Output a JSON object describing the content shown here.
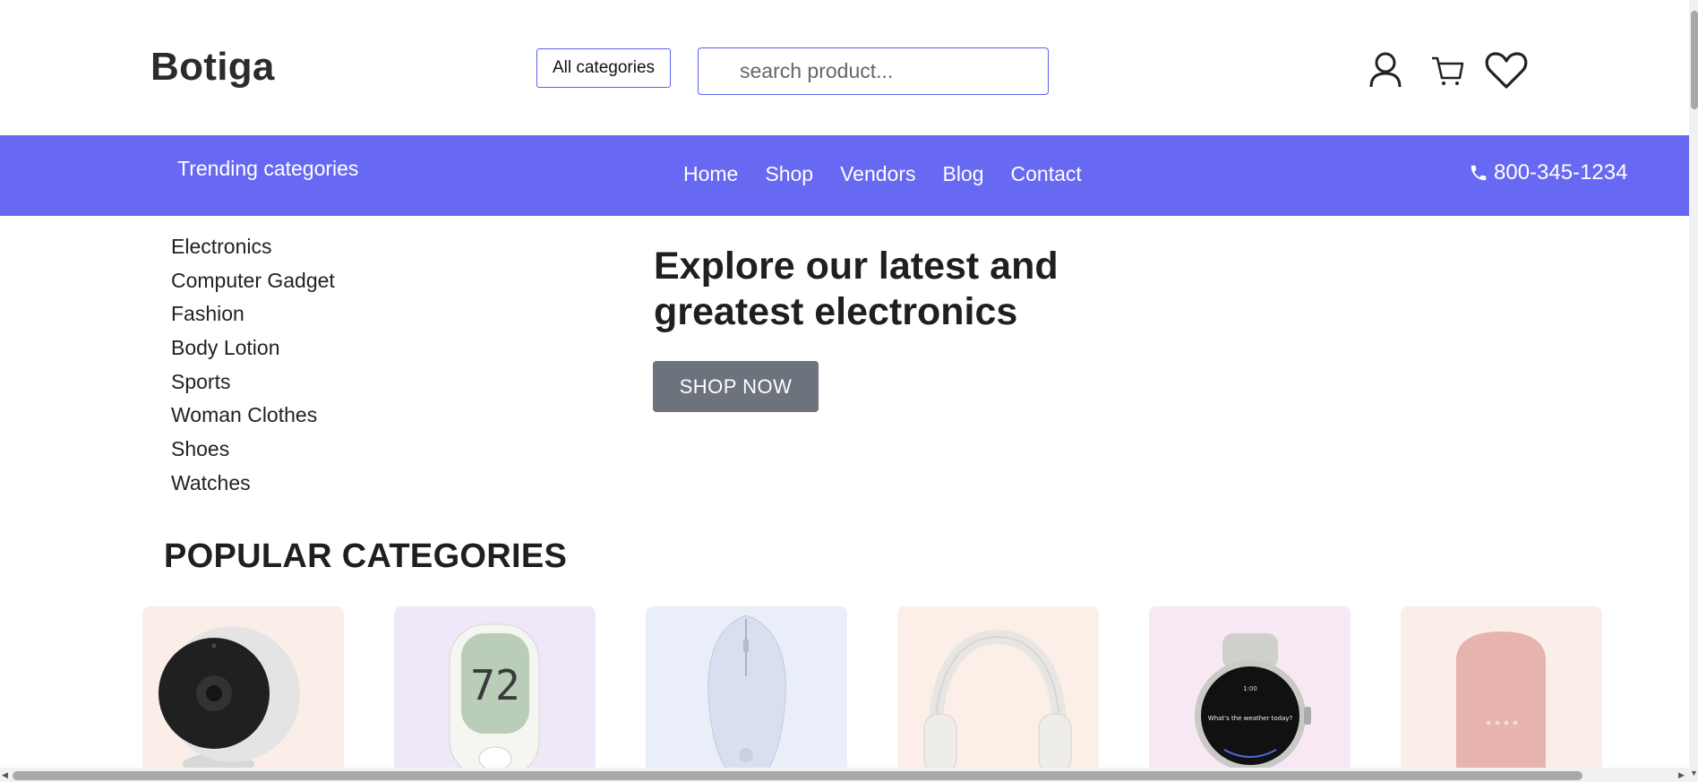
{
  "header": {
    "logo": "Botiga",
    "category_select": "All categories",
    "search_placeholder": "search product..."
  },
  "icons": {
    "account": "user-icon",
    "cart": "cart-icon",
    "wishlist": "heart-icon",
    "phone": "phone-icon"
  },
  "navbar": {
    "trending_label": "Trending categories",
    "links": [
      "Home",
      "Shop",
      "Vendors",
      "Blog",
      "Contact"
    ],
    "phone": "800-345-1234",
    "color": "#6869f2"
  },
  "categories": [
    "Electronics",
    "Computer Gadget",
    "Fashion",
    "Body Lotion",
    "Sports",
    "Woman Clothes",
    "Shoes",
    "Watches"
  ],
  "hero": {
    "title": "Explore our latest and greatest electronics",
    "button": "SHOP NOW"
  },
  "popular": {
    "heading": "POPULAR CATEGORIES",
    "cards": [
      {
        "name": "security-camera",
        "bg": "#fbeee8"
      },
      {
        "name": "thermostat",
        "bg": "#efe8f8",
        "display": "72"
      },
      {
        "name": "gaming-mouse",
        "bg": "#e9eef8"
      },
      {
        "name": "headphones",
        "bg": "#fbefe8"
      },
      {
        "name": "smartwatch",
        "bg": "#f8e8f3",
        "display": "1:00",
        "subtext": "What's the weather today?"
      },
      {
        "name": "smart-speaker",
        "bg": "#fbeee8"
      }
    ]
  }
}
